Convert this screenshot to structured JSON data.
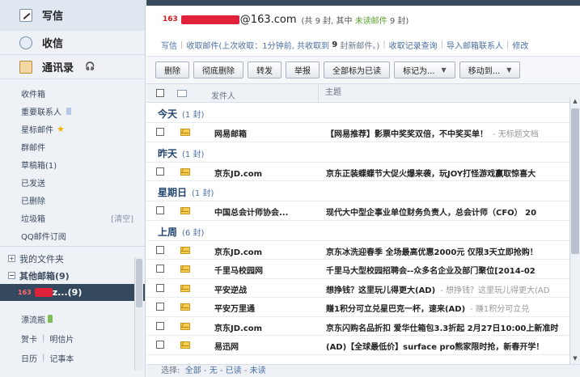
{
  "sidebar": {
    "write_label": "写信",
    "inbox_label": "收信",
    "contacts_label": "通讯录",
    "contacts_aux": "🎧",
    "folders": [
      {
        "label": "收件箱"
      },
      {
        "label": "重要联系人"
      },
      {
        "label": "星标邮件"
      },
      {
        "label": "群邮件"
      },
      {
        "label": "草稿箱(1)"
      },
      {
        "label": "已发送"
      },
      {
        "label": "已删除"
      },
      {
        "label": "垃圾箱",
        "action": "[清空]"
      },
      {
        "label": "QQ邮件订阅"
      }
    ],
    "my_folders": "我的文件夹",
    "other_mailboxes": "其他邮箱(9)",
    "account_logo": "163",
    "account_suffix": "z...(9)",
    "drift_bottle": "漂流瓶",
    "card": "贺卡",
    "postcard": "明信片",
    "calendar": "日历",
    "notes": "记事本"
  },
  "header": {
    "logo": "163",
    "address_suffix": "@163.com",
    "count_prefix": "(共 9 封, 其中",
    "count_unread": "未读邮件",
    "count_suffix": "9 封)"
  },
  "subbar": {
    "write": "写信",
    "receive": "收取邮件(上次收取：1分钟前, 共收取到",
    "received_count": "9",
    "receive_suffix": "封新邮件。)",
    "query": "收取记录查询",
    "import": "导入邮箱联系人",
    "modify": "修改"
  },
  "toolbar": {
    "delete": "删除",
    "purge": "彻底删除",
    "forward": "转发",
    "report": "举报",
    "mark_all_read": "全部标为已读",
    "mark_as": "标记为...",
    "move_to": "移动到..."
  },
  "columns": {
    "sender": "发件人",
    "subject": "主题"
  },
  "groups": [
    {
      "label": "今天",
      "count": "(1 封)"
    },
    {
      "label": "昨天",
      "count": "(1 封)"
    },
    {
      "label": "星期日",
      "count": "(1 封)"
    },
    {
      "label": "上周",
      "count": "(6 封)"
    }
  ],
  "emails": [
    {
      "sender": "网易邮箱",
      "subject": "【网易推荐】影票中奖奖双倍，不中奖买单！",
      "preview": "- 无标题文档"
    },
    {
      "sender": "京东JD.com",
      "subject": "京东正装蝶蝶节大促火爆来袭，玩JOY打怪游戏赢取惊喜大",
      "preview": ""
    },
    {
      "sender": "中国总会计师协会...",
      "subject": "现代大中型企事业单位财务负责人，总会计师（CFO）  20",
      "preview": ""
    },
    {
      "sender": "京东JD.com",
      "subject": "京东冰洗迎春季 全场最高优惠2000元 仅限3天立即抢购！",
      "preview": ""
    },
    {
      "sender": "千里马校园网",
      "subject": "千里马大型校园招聘会--众多名企业及部门聚位[2014-02",
      "preview": ""
    },
    {
      "sender": "平安逆战",
      "subject": "想挣钱？这里玩儿得更大(AD)",
      "preview": "- 想挣钱？这里玩儿得更大(AD"
    },
    {
      "sender": "平安万里通",
      "subject": "赚1积分可立兑星巴克一杯，速来(AD)",
      "preview": "- 赚1积分可立兑"
    },
    {
      "sender": "京东JD.com",
      "subject": "京东闪购名品折扣 爱华仕箱包3.3折起 2月27日10:00上新准时",
      "preview": ""
    },
    {
      "sender": "易迅网",
      "subject": "(AD)【全球最低价】surface pro熊家限时抢，新春开学！",
      "preview": ""
    }
  ],
  "footer": {
    "select": "选择:",
    "all": "全部",
    "none": "无",
    "read": "已读",
    "unread": "未读"
  }
}
